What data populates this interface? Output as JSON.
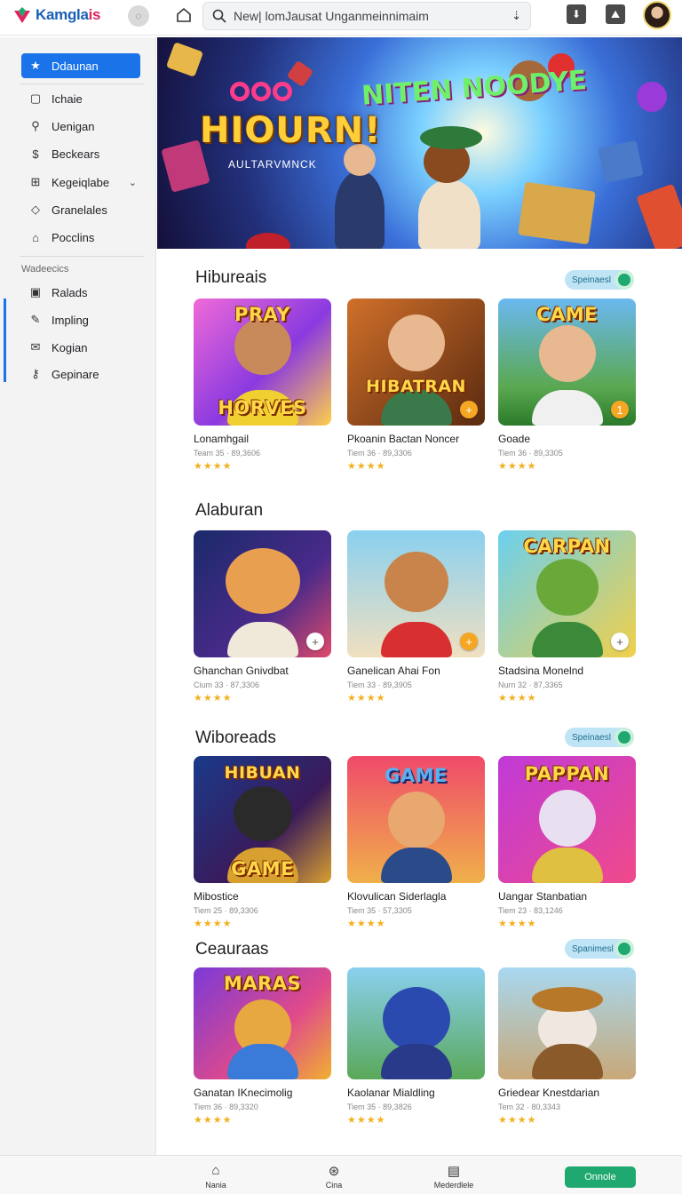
{
  "app": {
    "logo_text": "Kamgla",
    "logo_accent": "is",
    "brand_color": "#1a73e8"
  },
  "search": {
    "placeholder": "New| lomJausat Unganmeinnimaim"
  },
  "sidebar": {
    "items": [
      {
        "label": "Ddaunan",
        "icon": "star-icon",
        "active": true
      },
      {
        "label": "Ichaie",
        "icon": "code-icon"
      },
      {
        "label": "Uenigan",
        "icon": "search-icon"
      },
      {
        "label": "Beckears",
        "icon": "dollar-icon"
      },
      {
        "label": "Kegeiqlabe",
        "icon": "grid-icon",
        "expandable": true
      },
      {
        "label": "Granelales",
        "icon": "tag-icon"
      },
      {
        "label": "Pocclins",
        "icon": "inbox-icon"
      }
    ],
    "section_label": "Wadeecics",
    "section_items": [
      {
        "label": "Ralads",
        "icon": "square-icon"
      },
      {
        "label": "Impling",
        "icon": "edit-icon"
      },
      {
        "label": "Kogian",
        "icon": "mail-icon"
      },
      {
        "label": "Gepinare",
        "icon": "key-icon"
      }
    ]
  },
  "hero": {
    "title": "HIOURN!",
    "title2": "NITEN NOODYE",
    "subtitle": "AULTARVMNCK"
  },
  "sections": [
    {
      "title": "Hibureais",
      "button": "Speinaesl",
      "cards": [
        {
          "name": "Lonamhgail",
          "meta": "Team 35 · 89,3606",
          "stars": "★★★★",
          "thumb_title": "PRAY\nHORVES",
          "badge": ""
        },
        {
          "name": "Pkoanin Bactan Noncer",
          "meta": "Tiem 36 · 89,3306",
          "stars": "★★★★",
          "thumb_title": "HIBATRAN",
          "badge": "+"
        },
        {
          "name": "Goade",
          "meta": "Tiem 36 · 89,3305",
          "stars": "★★★★",
          "thumb_title": "CAME",
          "badge": "1"
        }
      ]
    },
    {
      "title": "Alaburan",
      "button": "",
      "cards": [
        {
          "name": "Ghanchan Gnivdbat",
          "meta": "Cium 33 · 87,3306",
          "stars": "★★★★",
          "thumb_title": "",
          "badge": "+"
        },
        {
          "name": "Ganelican Ahai Fon",
          "meta": "Tiem 33 · 89,3905",
          "stars": "★★★★",
          "thumb_title": "",
          "badge": "+"
        },
        {
          "name": "Stadsina Monelnd",
          "meta": "Nurn 32 · 87,3365",
          "stars": "★★★★",
          "thumb_title": "CARPAN",
          "badge": "+"
        }
      ]
    },
    {
      "title": "Wiboreads",
      "button": "Speinaesl",
      "cards": [
        {
          "name": "Mibostice",
          "meta": "Tiem 25 · 89,3306",
          "stars": "★★★★",
          "thumb_title": "HIBUAN\nGAME",
          "badge": ""
        },
        {
          "name": "Klovulican Siderlagla",
          "meta": "Tiem 35 · 57,3305",
          "stars": "★★★★",
          "thumb_title": "GAME",
          "badge": ""
        },
        {
          "name": "Uangar Stanbatian",
          "meta": "Tiem 23 · 83,1246",
          "stars": "★★★★",
          "thumb_title": "PAPPAN",
          "badge": ""
        }
      ]
    },
    {
      "title": "Ceauraas",
      "button": "Spanimesl",
      "cards": [
        {
          "name": "Ganatan IKnecimolig",
          "meta": "Tiem 36 · 89,3320",
          "stars": "★★★★",
          "thumb_title": "MARAS",
          "badge": ""
        },
        {
          "name": "Kaolanar Mialdling",
          "meta": "Tiem 35 · 89,3826",
          "stars": "★★★★",
          "thumb_title": "",
          "badge": ""
        },
        {
          "name": "Griedear Knestdarian",
          "meta": "Tem 32 · 80,3343",
          "stars": "★★★★",
          "thumb_title": "",
          "badge": ""
        }
      ]
    }
  ],
  "bottom_nav": {
    "items": [
      {
        "label": "Nania",
        "icon": "home-icon"
      },
      {
        "label": "Cina",
        "icon": "compass-icon"
      },
      {
        "label": "Mederdlele",
        "icon": "document-icon"
      }
    ],
    "cta": "Onnole"
  }
}
